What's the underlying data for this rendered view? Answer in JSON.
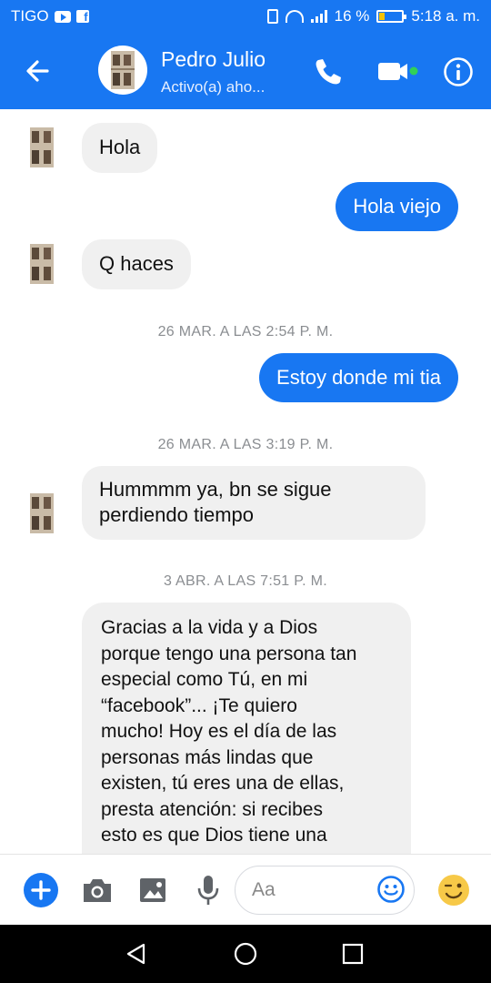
{
  "status_bar": {
    "carrier": "TIGO",
    "battery_percent": "16 %",
    "time": "5:18 a. m."
  },
  "header": {
    "contact_name": "Pedro Julio",
    "contact_status": "Activo(a) aho...",
    "icons": {
      "back": "arrow-left-icon",
      "call": "phone-icon",
      "video": "video-camera-icon",
      "info": "info-icon"
    },
    "online_dot_color": "#31d158"
  },
  "messages": [
    {
      "direction": "in",
      "text": "Hola"
    },
    {
      "direction": "out",
      "text": "Hola viejo"
    },
    {
      "direction": "in",
      "text": "Q haces"
    },
    {
      "timestamp": "26 MAR. A LAS 2:54 P. M."
    },
    {
      "direction": "out",
      "text": "Estoy donde mi tia"
    },
    {
      "timestamp": "26 MAR. A LAS 3:19 P. M."
    },
    {
      "direction": "in",
      "lines": [
        "Hummmm ya, bn se sigue",
        "perdiendo tiempo"
      ]
    },
    {
      "timestamp": "3 ABR. A LAS 7:51 P. M."
    },
    {
      "direction": "in",
      "lines": [
        "Gracias a la vida y a Dios",
        "porque tengo una persona tan",
        "especial como Tú, en mi",
        "“facebook”... ¡Te quiero",
        "mucho! Hoy es el día de las",
        "personas más lindas que",
        "existen, tú eres una de ellas,",
        "presta atención: si recibes",
        "esto es que Dios tiene una"
      ]
    }
  ],
  "composer": {
    "placeholder": "Aa",
    "icons": [
      "plus-icon",
      "camera-icon",
      "image-icon",
      "microphone-icon",
      "emoji-icon",
      "sticker-icon"
    ]
  },
  "colors": {
    "brand": "#1877f2",
    "incoming_bubble": "#f0f0f0",
    "timestamp_text": "#8a8d91",
    "sticker_yellow": "#f7c948"
  }
}
